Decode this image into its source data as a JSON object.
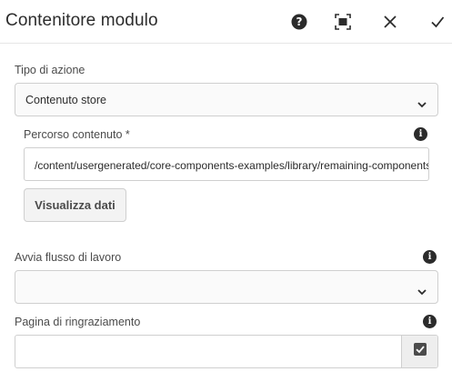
{
  "header": {
    "title": "Contenitore modulo",
    "icons": [
      "help-icon",
      "fullscreen-icon",
      "close-icon",
      "checkmark-icon"
    ]
  },
  "form": {
    "action_type": {
      "label": "Tipo di azione",
      "value": "Contenuto store"
    },
    "content_path": {
      "label": "Percorso contenuto *",
      "value": "/content/usergenerated/core-components-examples/library/remaining-components/form/container/jcr:content"
    },
    "view_data_button": "Visualizza dati",
    "workflow": {
      "label": "Avvia flusso di lavoro",
      "value": ""
    },
    "thank_you_page": {
      "label": "Pagina di ringraziamento",
      "value": ""
    }
  },
  "colors": {
    "text": "#2c2c2c",
    "label": "#4b4b4b",
    "border": "#cfcfcf",
    "icon": "#2b2b2b"
  }
}
